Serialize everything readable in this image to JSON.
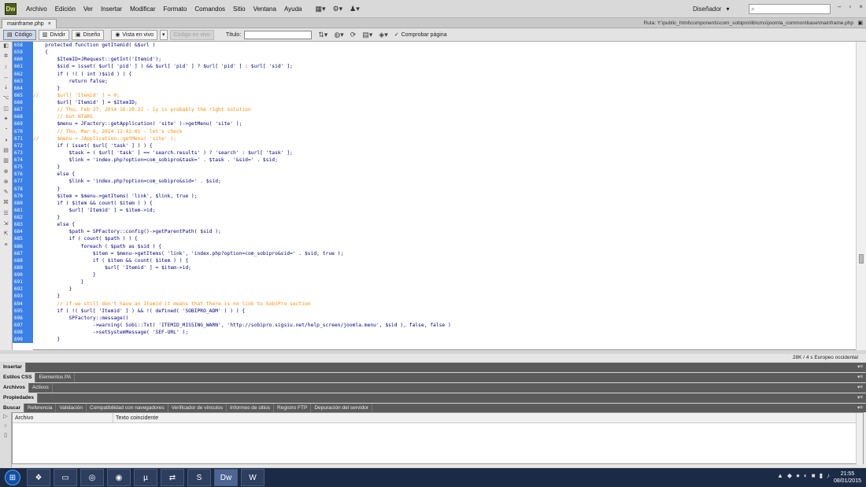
{
  "menubar": {
    "app_logo": "Dw",
    "items": [
      "Archivo",
      "Edición",
      "Ver",
      "Insertar",
      "Modificar",
      "Formato",
      "Comandos",
      "Sitio",
      "Ventana",
      "Ayuda"
    ],
    "icons": [
      "layout-icon",
      "gear-icon",
      "user-icon"
    ],
    "workspace": "Diseñador",
    "search_placeholder": "",
    "window_controls": [
      "–",
      "▫",
      "×"
    ]
  },
  "tabbar": {
    "doc_tab": "mainframe.php",
    "close": "×",
    "path": "Ruta:  Y:\\public_html\\components\\com_sobipro\\lib\\cms\\joomla_common\\base\\mainframe.php",
    "path_close": "▣"
  },
  "doc_toolbar": {
    "code": "Código",
    "split": "Dividir",
    "design": "Diseño",
    "live_view": "Vista en vivo",
    "inspect": "Código en vivo",
    "title_label": "Título:",
    "title_value": "",
    "check_page": "Comprobar página"
  },
  "editor": {
    "line_numbers": [
      "658",
      "659",
      "660",
      "661",
      "662",
      "663",
      "664",
      "665",
      "666",
      "667",
      "668",
      "669",
      "670",
      "671",
      "672",
      "673",
      "674",
      "675",
      "676",
      "677",
      "678",
      "679",
      "680",
      "681",
      "682",
      "683",
      "684",
      "685",
      "686",
      "687",
      "688",
      "689",
      "690",
      "691",
      "692",
      "693",
      "694",
      "695",
      "696",
      "697",
      "698",
      "699"
    ],
    "lines": [
      {
        "code": "    protected function getItemid( &$url )",
        "comment": ""
      },
      {
        "code": "    {",
        "comment": ""
      },
      {
        "code": "        $ItemID=JRequest::getInt('Itemid');",
        "comment": ""
      },
      {
        "code": "        $sid = isset( $url[ 'pid' ] ) && $url[ 'pid' ] ? $url[ 'pid' ] : $url[ 'sid' ];",
        "comment": ""
      },
      {
        "code": "        if ( !( ( int )$sid ) ) {",
        "comment": ""
      },
      {
        "code": "            return false;",
        "comment": ""
      },
      {
        "code": "        }",
        "comment": ""
      },
      {
        "code": "",
        "comment": "//      $url[ 'Itemid' ] = 0;"
      },
      {
        "code": "        $url[ 'Itemid' ] = $ItemID;",
        "comment": ""
      },
      {
        "code": "",
        "comment": "        // Thu, Feb 27, 2014 16:20:22 - iy is probably the right solution"
      },
      {
        "code": "",
        "comment": "        // but NTaRS"
      },
      {
        "code": "        $menu = JFactory::getApplication( 'site' )->getMenu( 'site' );",
        "comment": ""
      },
      {
        "code": "",
        "comment": "        // Thu, Mar 6, 2014 12:42:01 - let's check"
      },
      {
        "code": "",
        "comment": "//      $menu = JApplication::getMenu( 'site' );"
      },
      {
        "code": "        if ( isset( $url[ 'task' ] ) ) {",
        "comment": ""
      },
      {
        "code": "            $task = ( $url[ 'task' ] == 'search.results' ) ? 'search' : $url[ 'task' ];",
        "comment": ""
      },
      {
        "code": "            $link = 'index.php?option=com_sobipro&task=' . $task . '&sid=' . $sid;",
        "comment": ""
      },
      {
        "code": "        }",
        "comment": ""
      },
      {
        "code": "        else {",
        "comment": ""
      },
      {
        "code": "            $link = 'index.php?option=com_sobipro&sid=' . $sid;",
        "comment": ""
      },
      {
        "code": "        }",
        "comment": ""
      },
      {
        "code": "        $item = $menu->getItems( 'link', $link, true );",
        "comment": ""
      },
      {
        "code": "        if ( $item && count( $item ) ) {",
        "comment": ""
      },
      {
        "code": "            $url[ 'Itemid' ] = $item->id;",
        "comment": ""
      },
      {
        "code": "        }",
        "comment": ""
      },
      {
        "code": "        else {",
        "comment": ""
      },
      {
        "code": "            $path = SPFactory::config()->getParentPath( $sid );",
        "comment": ""
      },
      {
        "code": "            if ( count( $path ) ) {",
        "comment": ""
      },
      {
        "code": "                foreach ( $path as $sid ) {",
        "comment": ""
      },
      {
        "code": "                    $item = $menu->getItems( 'link', 'index.php?option=com_sobipro&sid=' . $sid, true );",
        "comment": ""
      },
      {
        "code": "                    if ( $item && count( $item ) ) {",
        "comment": ""
      },
      {
        "code": "                        $url[ 'Itemid' ] = $item->id;",
        "comment": ""
      },
      {
        "code": "                    }",
        "comment": ""
      },
      {
        "code": "                }",
        "comment": ""
      },
      {
        "code": "            }",
        "comment": ""
      },
      {
        "code": "        }",
        "comment": ""
      },
      {
        "code": "",
        "comment": "        // if we still don't have an Itemid it means that there is no link to SobiPro section"
      },
      {
        "code": "        if ( !( $url[ 'Itemid' ] ) && !( defined( 'SOBIPRO_ADM' ) ) ) {",
        "comment": ""
      },
      {
        "code": "            SPFactory::message()",
        "comment": ""
      },
      {
        "code": "                    ->warning( Sobi::Txt( 'ITEMID_MISSING_WARN', 'http://sobipro.sigsiu.net/help_screen/joomla.menu', $sid ), false, false )",
        "comment": ""
      },
      {
        "code": "                    ->setSystemMessage( 'SEF-URL' );",
        "comment": ""
      },
      {
        "code": "        }",
        "comment": ""
      }
    ]
  },
  "status": "28K / 4 s  Europeo occidental",
  "panels": {
    "insert": "Insertar",
    "css_tab1": "Estilos CSS",
    "css_tab2": "Elementos PA",
    "files_tab1": "Archivos",
    "files_tab2": "Activos",
    "properties": "Propiedades",
    "results_tabs": [
      "Buscar",
      "Referencia",
      "Validación",
      "Compatibilidad con navegadores",
      "Verificador de vínculos",
      "Informes de sitios",
      "Registro FTP",
      "Depuración del servidor"
    ],
    "col_file": "Archivo",
    "col_match": "Texto coincidente",
    "menu_icon": "▾≡"
  },
  "taskbar": {
    "time": "21:55",
    "date": "08/01/2015"
  }
}
